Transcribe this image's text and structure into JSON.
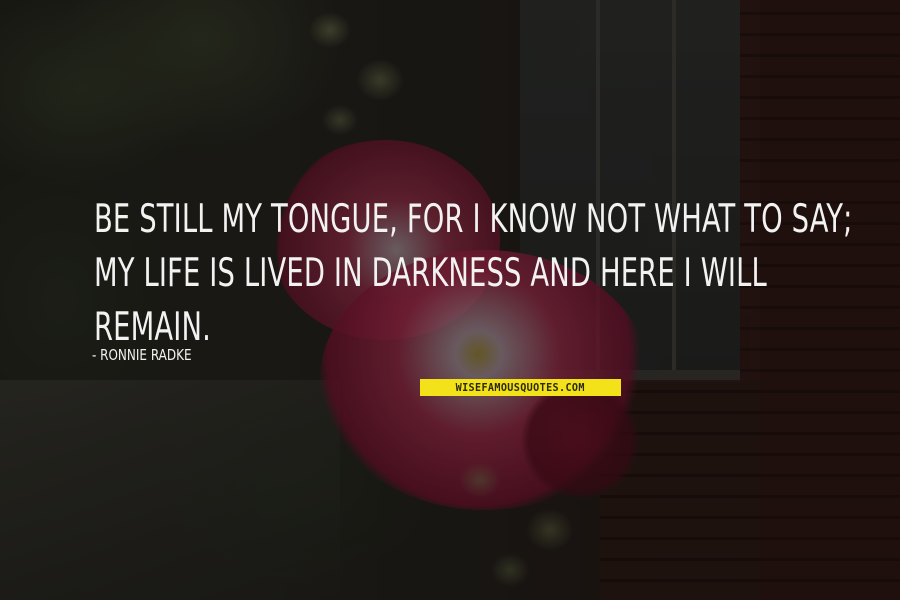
{
  "quote": {
    "lines": [
      "BE STILL MY TONGUE, FOR I KNOW NOT WHAT TO SAY;",
      "MY LIFE IS LIVED IN DARKNESS AND HERE I WILL",
      "REMAIN."
    ],
    "author": "- RONNIE RADKE"
  },
  "watermark": {
    "text": "WISEFAMOUSQUOTES.COM"
  },
  "colors": {
    "text": "#f2f2f2",
    "watermark_bg": "#f3e21a",
    "flower": "#c23458",
    "brick": "#3a1d18"
  }
}
